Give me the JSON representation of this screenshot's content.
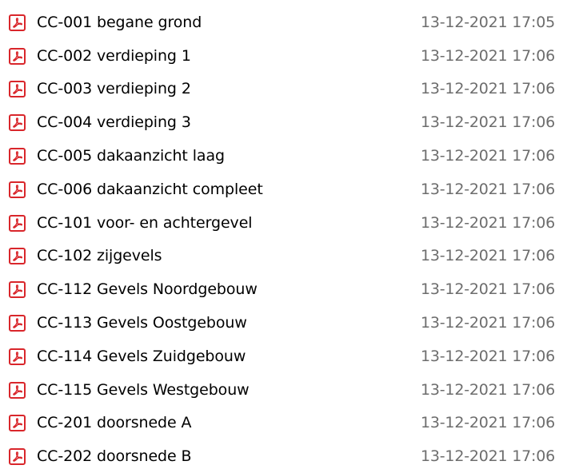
{
  "files": [
    {
      "name": "CC-001 begane grond",
      "modified": "13-12-2021 17:05",
      "icon": "pdf-icon"
    },
    {
      "name": "CC-002 verdieping 1",
      "modified": "13-12-2021 17:06",
      "icon": "pdf-icon"
    },
    {
      "name": "CC-003 verdieping 2",
      "modified": "13-12-2021 17:06",
      "icon": "pdf-icon"
    },
    {
      "name": "CC-004 verdieping 3",
      "modified": "13-12-2021 17:06",
      "icon": "pdf-icon"
    },
    {
      "name": "CC-005 dakaanzicht laag",
      "modified": "13-12-2021 17:06",
      "icon": "pdf-icon"
    },
    {
      "name": "CC-006 dakaanzicht compleet",
      "modified": "13-12-2021 17:06",
      "icon": "pdf-icon"
    },
    {
      "name": "CC-101 voor- en achtergevel",
      "modified": "13-12-2021 17:06",
      "icon": "pdf-icon"
    },
    {
      "name": "CC-102 zijgevels",
      "modified": "13-12-2021 17:06",
      "icon": "pdf-icon"
    },
    {
      "name": "CC-112 Gevels Noordgebouw",
      "modified": "13-12-2021 17:06",
      "icon": "pdf-icon"
    },
    {
      "name": "CC-113 Gevels Oostgebouw",
      "modified": "13-12-2021 17:06",
      "icon": "pdf-icon"
    },
    {
      "name": "CC-114 Gevels Zuidgebouw",
      "modified": "13-12-2021 17:06",
      "icon": "pdf-icon"
    },
    {
      "name": "CC-115 Gevels Westgebouw",
      "modified": "13-12-2021 17:06",
      "icon": "pdf-icon"
    },
    {
      "name": "CC-201 doorsnede A",
      "modified": "13-12-2021 17:06",
      "icon": "pdf-icon"
    },
    {
      "name": "CC-202 doorsnede B",
      "modified": "13-12-2021 17:06",
      "icon": "pdf-icon"
    }
  ],
  "colors": {
    "pdf_icon_red": "#d9262b",
    "date_text": "#6d6d6d"
  }
}
